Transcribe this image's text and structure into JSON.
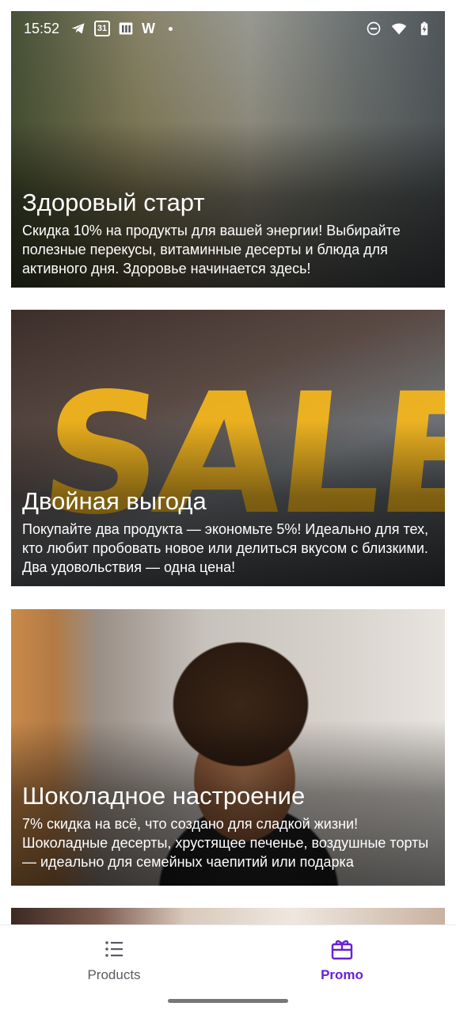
{
  "status_bar": {
    "time": "15:52",
    "icons_left": [
      "telegram-icon",
      "calendar-icon",
      "news-icon",
      "w-icon",
      "dot-icon"
    ],
    "calendar_day": "31",
    "w_letter": "W",
    "icons_right": [
      "do-not-disturb-icon",
      "wifi-icon",
      "battery-charging-icon"
    ]
  },
  "promos": [
    {
      "title": "Здоровый старт",
      "description": "Скидка 10% на продукты для вашей энергии! Выбирайте полезные перекусы, витаминные десерты и блюда для активного дня. Здоровье начинается здесь!"
    },
    {
      "title": "Двойная выгода",
      "description": "Покупайте два продукта — экономьте 5%! Идеально для тех, кто любит пробовать новое или делиться вкусом с близкими. Два удовольствия — одна цена!",
      "image_text": "SALE"
    },
    {
      "title": "Шоколадное настроение",
      "description": "7% скидка на всё, что создано для сладкой жизни! Шоколадные десерты, хрустящее печенье, воздушные торты — идеально для семейных чаепитий или подарка"
    }
  ],
  "bottom_nav": {
    "items": [
      {
        "label": "Products",
        "icon": "list-icon",
        "active": false
      },
      {
        "label": "Promo",
        "icon": "gift-icon",
        "active": true
      }
    ]
  },
  "colors": {
    "accent": "#6a1fd8",
    "inactive": "#5b5b63",
    "sale_yellow": "#f7b81c"
  }
}
